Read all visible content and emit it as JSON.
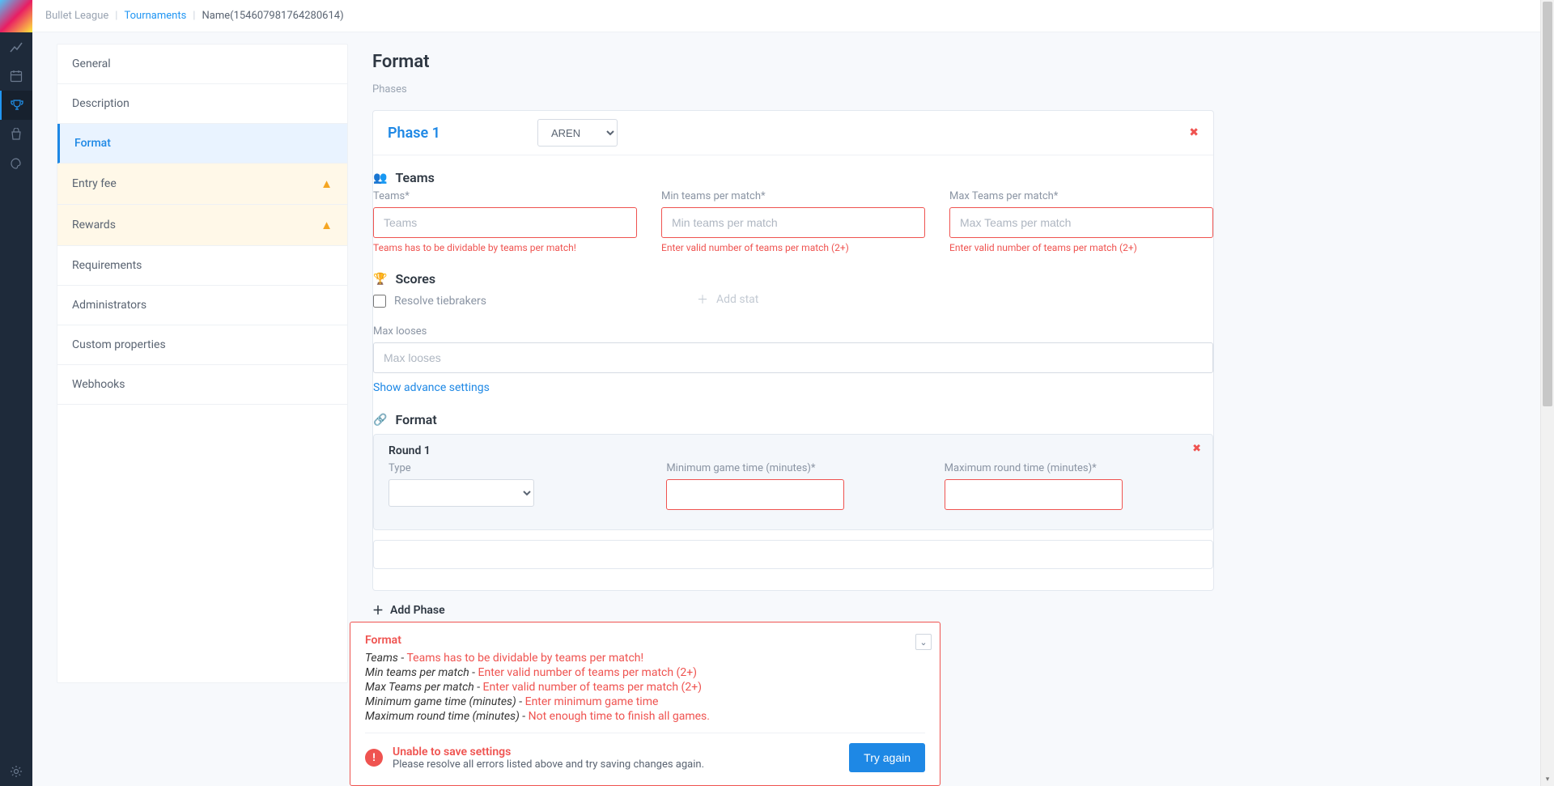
{
  "breadcrumb": {
    "root": "Bullet League",
    "mid": "Tournaments",
    "name": "Name(1546079817642806​14)"
  },
  "leftnav": {
    "general": "General",
    "description": "Description",
    "format": "Format",
    "entry_fee": "Entry fee",
    "rewards": "Rewards",
    "requirements": "Requirements",
    "administrators": "Administrators",
    "custom_properties": "Custom properties",
    "webhooks": "Webhooks"
  },
  "title": "Format",
  "phases_label": "Phases",
  "phase": {
    "name": "Phase 1",
    "type_value": "AREN",
    "teams_section": "Teams",
    "teams": {
      "label": "Teams*",
      "placeholder": "Teams",
      "error": "Teams has to be dividable by teams per match!"
    },
    "min_teams": {
      "label": "Min teams per match*",
      "placeholder": "Min teams per match",
      "error": "Enter valid number of teams per match (2+)"
    },
    "max_teams": {
      "label": "Max Teams per match*",
      "placeholder": "Max Teams per match",
      "error": "Enter valid number of teams per match (2+)"
    },
    "scores_section": "Scores",
    "resolve_tie": "Resolve tiebrakers",
    "add_stat": "Add stat",
    "max_looses": {
      "label": "Max looses",
      "placeholder": "Max looses"
    },
    "show_advance": "Show advance settings",
    "format_section": "Format",
    "round": {
      "title": "Round 1",
      "type_label": "Type",
      "min_game_label": "Minimum game time (minutes)*",
      "max_round_label": "Maximum round time (minutes)*"
    },
    "add_phase": "Add Phase"
  },
  "popover": {
    "title": "Format",
    "lines": [
      {
        "field": "Teams",
        "msg": "Teams has to be dividable by teams per match!"
      },
      {
        "field": "Min teams per match",
        "msg": "Enter valid number of teams per match (2+)"
      },
      {
        "field": "Max Teams per match",
        "msg": "Enter valid number of teams per match (2+)"
      },
      {
        "field": "Minimum game time (minutes)",
        "msg": "Enter minimum game time"
      },
      {
        "field": "Maximum round time (minutes)",
        "msg": "Not enough time to finish all games."
      }
    ],
    "unable_title": "Unable to save settings",
    "unable_sub": "Please resolve all errors listed above and try saving changes again.",
    "try_again": "Try again"
  }
}
